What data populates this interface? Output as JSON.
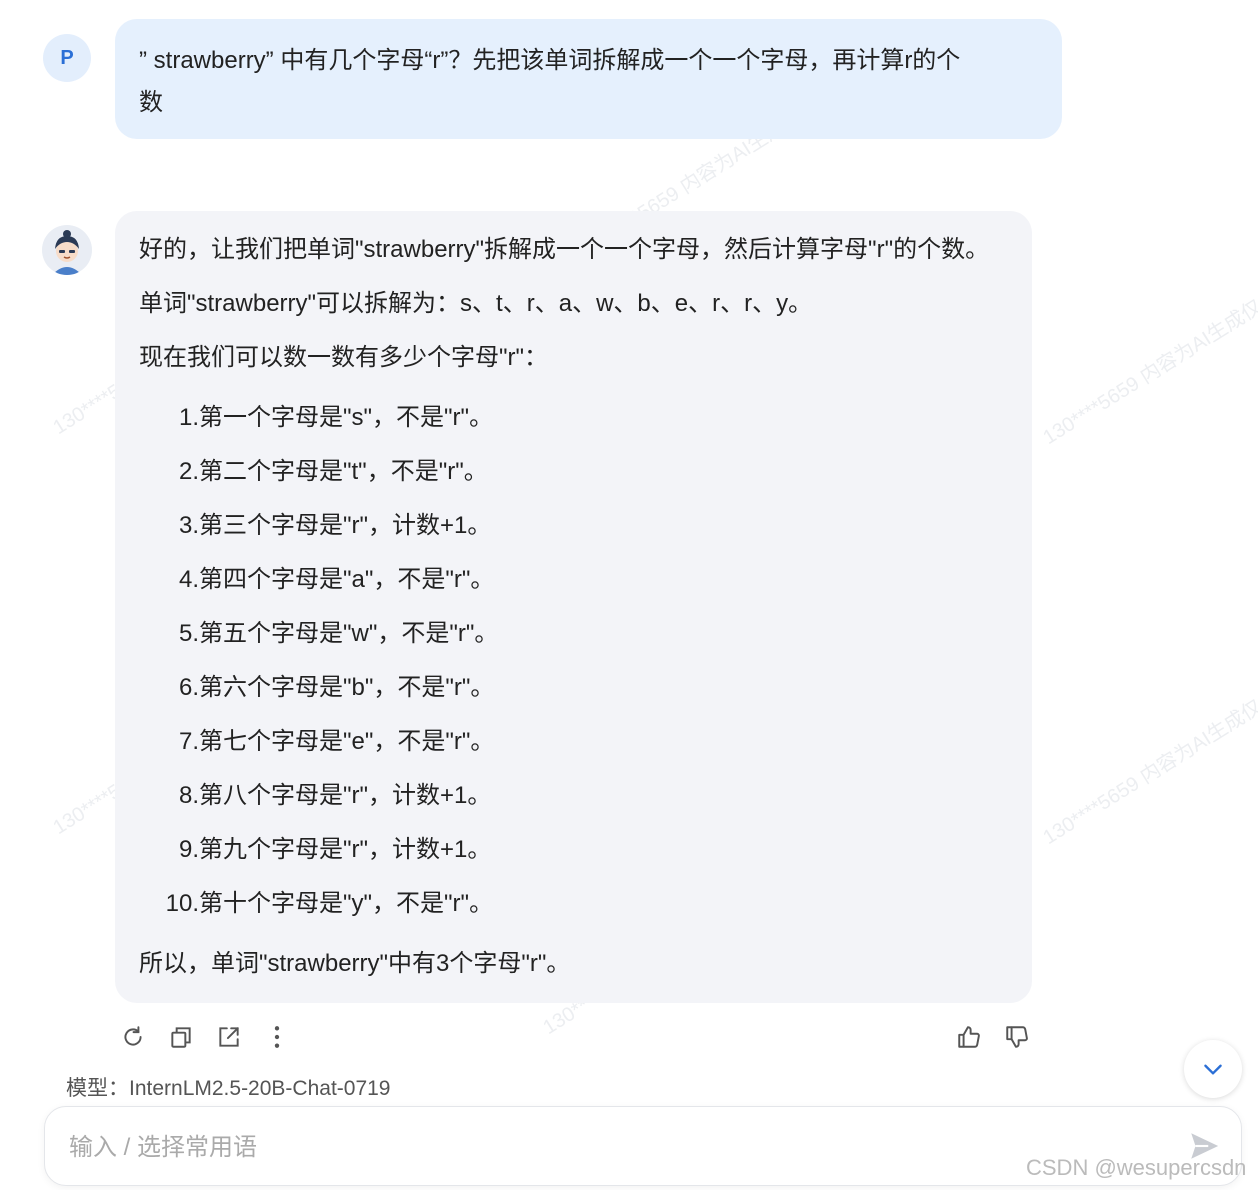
{
  "user": {
    "avatar_letter": "P",
    "message_line1": "” strawberry” 中有几个字母“r”？先把该单词拆解成一个一个字母，再计算r的个",
    "message_line2": "数"
  },
  "bot": {
    "intro": "好的，让我们把单词\"strawberry\"拆解成一个一个字母，然后计算字母\"r\"的个数。",
    "split": "单词\"strawberry\"可以拆解为：s、t、r、a、w、b、e、r、r、y。",
    "count_intro": "现在我们可以数一数有多少个字母\"r\"：",
    "items": [
      {
        "num": "1.",
        "text": "第一个字母是\"s\"，不是\"r\"。"
      },
      {
        "num": "2.",
        "text": "第二个字母是\"t\"，不是\"r\"。"
      },
      {
        "num": "3.",
        "text": "第三个字母是\"r\"，计数+1。"
      },
      {
        "num": "4.",
        "text": "第四个字母是\"a\"，不是\"r\"。"
      },
      {
        "num": "5.",
        "text": "第五个字母是\"w\"，不是\"r\"。"
      },
      {
        "num": "6.",
        "text": "第六个字母是\"b\"，不是\"r\"。"
      },
      {
        "num": "7.",
        "text": "第七个字母是\"e\"，不是\"r\"。"
      },
      {
        "num": "8.",
        "text": "第八个字母是\"r\"，计数+1。"
      },
      {
        "num": "9.",
        "text": "第九个字母是\"r\"，计数+1。"
      },
      {
        "num": "10.",
        "text": "第十个字母是\"y\"，不是\"r\"。"
      }
    ],
    "conclusion": "所以，单词\"strawberry\"中有3个字母\"r\"。"
  },
  "actions": {
    "left_icons": [
      "refresh-icon",
      "copy-icon",
      "share-icon",
      "more-icon"
    ],
    "right_icons": [
      "thumbs-up-icon",
      "thumbs-down-icon"
    ]
  },
  "model_label": "模型：InternLM2.5-20B-Chat-0719",
  "input": {
    "placeholder": "输入 / 选择常用语",
    "value": ""
  },
  "watermark_text": "130****5659 内容为AI生成仅供参考",
  "footer_watermark": "CSDN @wesupercsdn",
  "colors": {
    "user_bubble": "#e5f0fd",
    "bot_bubble": "#f3f4f8",
    "accent": "#2b6fd6"
  }
}
